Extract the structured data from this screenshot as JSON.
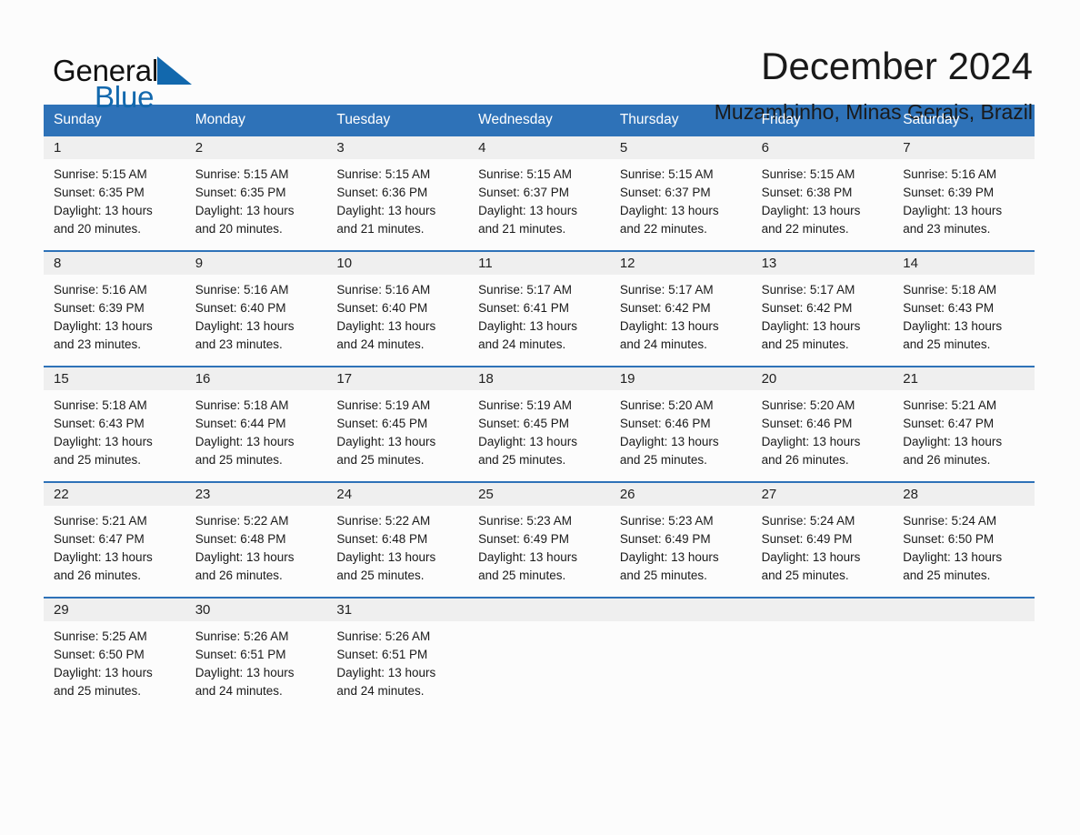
{
  "brand": {
    "name_part1": "General",
    "name_part2": "Blue",
    "triangle_color": "#1268ad"
  },
  "header": {
    "title": "December 2024",
    "subtitle": "Muzambinho, Minas Gerais, Brazil"
  },
  "theme": {
    "header_blue": "#2e72b8",
    "day_band_gray": "#efefef",
    "text": "#1a1a1a"
  },
  "weekdays": [
    "Sunday",
    "Monday",
    "Tuesday",
    "Wednesday",
    "Thursday",
    "Friday",
    "Saturday"
  ],
  "weeks": [
    [
      {
        "day": "1",
        "sunrise": "Sunrise: 5:15 AM",
        "sunset": "Sunset: 6:35 PM",
        "daylight_line1": "Daylight: 13 hours",
        "daylight_line2": "and 20 minutes."
      },
      {
        "day": "2",
        "sunrise": "Sunrise: 5:15 AM",
        "sunset": "Sunset: 6:35 PM",
        "daylight_line1": "Daylight: 13 hours",
        "daylight_line2": "and 20 minutes."
      },
      {
        "day": "3",
        "sunrise": "Sunrise: 5:15 AM",
        "sunset": "Sunset: 6:36 PM",
        "daylight_line1": "Daylight: 13 hours",
        "daylight_line2": "and 21 minutes."
      },
      {
        "day": "4",
        "sunrise": "Sunrise: 5:15 AM",
        "sunset": "Sunset: 6:37 PM",
        "daylight_line1": "Daylight: 13 hours",
        "daylight_line2": "and 21 minutes."
      },
      {
        "day": "5",
        "sunrise": "Sunrise: 5:15 AM",
        "sunset": "Sunset: 6:37 PM",
        "daylight_line1": "Daylight: 13 hours",
        "daylight_line2": "and 22 minutes."
      },
      {
        "day": "6",
        "sunrise": "Sunrise: 5:15 AM",
        "sunset": "Sunset: 6:38 PM",
        "daylight_line1": "Daylight: 13 hours",
        "daylight_line2": "and 22 minutes."
      },
      {
        "day": "7",
        "sunrise": "Sunrise: 5:16 AM",
        "sunset": "Sunset: 6:39 PM",
        "daylight_line1": "Daylight: 13 hours",
        "daylight_line2": "and 23 minutes."
      }
    ],
    [
      {
        "day": "8",
        "sunrise": "Sunrise: 5:16 AM",
        "sunset": "Sunset: 6:39 PM",
        "daylight_line1": "Daylight: 13 hours",
        "daylight_line2": "and 23 minutes."
      },
      {
        "day": "9",
        "sunrise": "Sunrise: 5:16 AM",
        "sunset": "Sunset: 6:40 PM",
        "daylight_line1": "Daylight: 13 hours",
        "daylight_line2": "and 23 minutes."
      },
      {
        "day": "10",
        "sunrise": "Sunrise: 5:16 AM",
        "sunset": "Sunset: 6:40 PM",
        "daylight_line1": "Daylight: 13 hours",
        "daylight_line2": "and 24 minutes."
      },
      {
        "day": "11",
        "sunrise": "Sunrise: 5:17 AM",
        "sunset": "Sunset: 6:41 PM",
        "daylight_line1": "Daylight: 13 hours",
        "daylight_line2": "and 24 minutes."
      },
      {
        "day": "12",
        "sunrise": "Sunrise: 5:17 AM",
        "sunset": "Sunset: 6:42 PM",
        "daylight_line1": "Daylight: 13 hours",
        "daylight_line2": "and 24 minutes."
      },
      {
        "day": "13",
        "sunrise": "Sunrise: 5:17 AM",
        "sunset": "Sunset: 6:42 PM",
        "daylight_line1": "Daylight: 13 hours",
        "daylight_line2": "and 25 minutes."
      },
      {
        "day": "14",
        "sunrise": "Sunrise: 5:18 AM",
        "sunset": "Sunset: 6:43 PM",
        "daylight_line1": "Daylight: 13 hours",
        "daylight_line2": "and 25 minutes."
      }
    ],
    [
      {
        "day": "15",
        "sunrise": "Sunrise: 5:18 AM",
        "sunset": "Sunset: 6:43 PM",
        "daylight_line1": "Daylight: 13 hours",
        "daylight_line2": "and 25 minutes."
      },
      {
        "day": "16",
        "sunrise": "Sunrise: 5:18 AM",
        "sunset": "Sunset: 6:44 PM",
        "daylight_line1": "Daylight: 13 hours",
        "daylight_line2": "and 25 minutes."
      },
      {
        "day": "17",
        "sunrise": "Sunrise: 5:19 AM",
        "sunset": "Sunset: 6:45 PM",
        "daylight_line1": "Daylight: 13 hours",
        "daylight_line2": "and 25 minutes."
      },
      {
        "day": "18",
        "sunrise": "Sunrise: 5:19 AM",
        "sunset": "Sunset: 6:45 PM",
        "daylight_line1": "Daylight: 13 hours",
        "daylight_line2": "and 25 minutes."
      },
      {
        "day": "19",
        "sunrise": "Sunrise: 5:20 AM",
        "sunset": "Sunset: 6:46 PM",
        "daylight_line1": "Daylight: 13 hours",
        "daylight_line2": "and 25 minutes."
      },
      {
        "day": "20",
        "sunrise": "Sunrise: 5:20 AM",
        "sunset": "Sunset: 6:46 PM",
        "daylight_line1": "Daylight: 13 hours",
        "daylight_line2": "and 26 minutes."
      },
      {
        "day": "21",
        "sunrise": "Sunrise: 5:21 AM",
        "sunset": "Sunset: 6:47 PM",
        "daylight_line1": "Daylight: 13 hours",
        "daylight_line2": "and 26 minutes."
      }
    ],
    [
      {
        "day": "22",
        "sunrise": "Sunrise: 5:21 AM",
        "sunset": "Sunset: 6:47 PM",
        "daylight_line1": "Daylight: 13 hours",
        "daylight_line2": "and 26 minutes."
      },
      {
        "day": "23",
        "sunrise": "Sunrise: 5:22 AM",
        "sunset": "Sunset: 6:48 PM",
        "daylight_line1": "Daylight: 13 hours",
        "daylight_line2": "and 26 minutes."
      },
      {
        "day": "24",
        "sunrise": "Sunrise: 5:22 AM",
        "sunset": "Sunset: 6:48 PM",
        "daylight_line1": "Daylight: 13 hours",
        "daylight_line2": "and 25 minutes."
      },
      {
        "day": "25",
        "sunrise": "Sunrise: 5:23 AM",
        "sunset": "Sunset: 6:49 PM",
        "daylight_line1": "Daylight: 13 hours",
        "daylight_line2": "and 25 minutes."
      },
      {
        "day": "26",
        "sunrise": "Sunrise: 5:23 AM",
        "sunset": "Sunset: 6:49 PM",
        "daylight_line1": "Daylight: 13 hours",
        "daylight_line2": "and 25 minutes."
      },
      {
        "day": "27",
        "sunrise": "Sunrise: 5:24 AM",
        "sunset": "Sunset: 6:49 PM",
        "daylight_line1": "Daylight: 13 hours",
        "daylight_line2": "and 25 minutes."
      },
      {
        "day": "28",
        "sunrise": "Sunrise: 5:24 AM",
        "sunset": "Sunset: 6:50 PM",
        "daylight_line1": "Daylight: 13 hours",
        "daylight_line2": "and 25 minutes."
      }
    ],
    [
      {
        "day": "29",
        "sunrise": "Sunrise: 5:25 AM",
        "sunset": "Sunset: 6:50 PM",
        "daylight_line1": "Daylight: 13 hours",
        "daylight_line2": "and 25 minutes."
      },
      {
        "day": "30",
        "sunrise": "Sunrise: 5:26 AM",
        "sunset": "Sunset: 6:51 PM",
        "daylight_line1": "Daylight: 13 hours",
        "daylight_line2": "and 24 minutes."
      },
      {
        "day": "31",
        "sunrise": "Sunrise: 5:26 AM",
        "sunset": "Sunset: 6:51 PM",
        "daylight_line1": "Daylight: 13 hours",
        "daylight_line2": "and 24 minutes."
      },
      {
        "day": "",
        "sunrise": "",
        "sunset": "",
        "daylight_line1": "",
        "daylight_line2": ""
      },
      {
        "day": "",
        "sunrise": "",
        "sunset": "",
        "daylight_line1": "",
        "daylight_line2": ""
      },
      {
        "day": "",
        "sunrise": "",
        "sunset": "",
        "daylight_line1": "",
        "daylight_line2": ""
      },
      {
        "day": "",
        "sunrise": "",
        "sunset": "",
        "daylight_line1": "",
        "daylight_line2": ""
      }
    ]
  ]
}
